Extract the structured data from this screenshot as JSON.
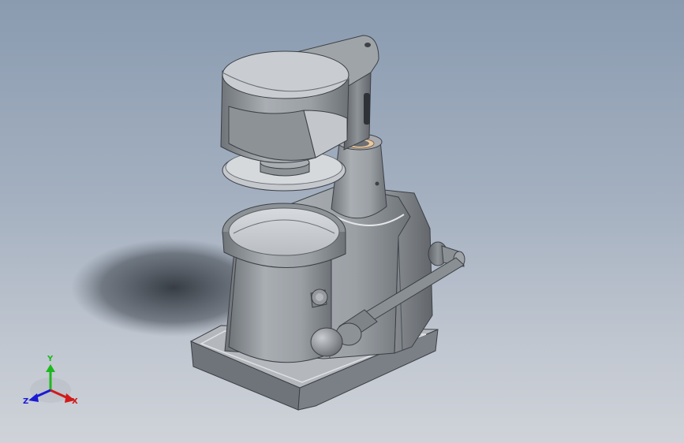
{
  "viewport": {
    "background_top": "#8a9bb0",
    "background_bottom": "#cfd3d9",
    "model_color": "#9aa0a6",
    "handle_color": "#7d8084",
    "accent_ring_color": "#e9c9a4"
  },
  "triad": {
    "x_label": "X",
    "y_label": "Y",
    "z_label": "Z",
    "x_color": "#d21a1a",
    "y_color": "#1db81d",
    "z_color": "#1a1ad2"
  }
}
